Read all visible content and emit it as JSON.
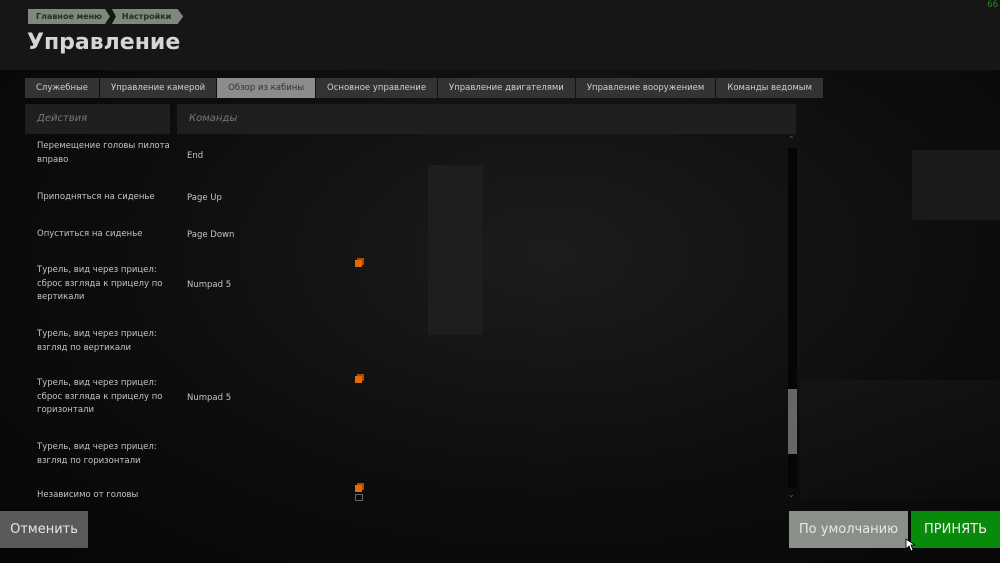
{
  "header": {
    "breadcrumbs": [
      "Главное меню",
      "Настройки"
    ],
    "title": "Управление",
    "fps": "66"
  },
  "tabs": [
    {
      "label": "Служебные"
    },
    {
      "label": "Управление камерой"
    },
    {
      "label": "Обзор из кабины",
      "active": true
    },
    {
      "label": "Основное управление"
    },
    {
      "label": "Управление двигателями"
    },
    {
      "label": "Управление вооружением"
    },
    {
      "label": "Команды ведомым"
    }
  ],
  "columns": {
    "actions": "Действия",
    "commands": "Команды"
  },
  "rows": [
    {
      "action": "Перемещение головы пилота вправо",
      "command": "End"
    },
    {
      "action": "Приподняться на сиденье",
      "command": "Page Up"
    },
    {
      "action": "Опуститься на сиденье",
      "command": "Page Down"
    },
    {
      "action": "Турель, вид через прицел: сброс взгляда к прицелу по вертикали",
      "command": "Numpad 5",
      "icon": "multi-binding-icon"
    },
    {
      "action": "Турель, вид через прицел: взгляд по вертикали",
      "command": ""
    },
    {
      "action": "Турель, вид через прицел: сброс взгляда к прицелу по горизонтали",
      "command": "Numpad 5",
      "icon": "multi-binding-icon"
    },
    {
      "action": "Турель, вид через прицел: взгляд по горизонтали",
      "command": ""
    },
    {
      "action": "Независимо от головы",
      "command": "",
      "icon": "multi-binding-icon"
    }
  ],
  "buttons": {
    "cancel": "Отменить",
    "default": "По умолчанию",
    "accept": "ПРИНЯТЬ"
  },
  "colors": {
    "accept": "#0a8a0a",
    "active_tab": "#8c8c8c",
    "binding_icon": "#e66a00"
  }
}
